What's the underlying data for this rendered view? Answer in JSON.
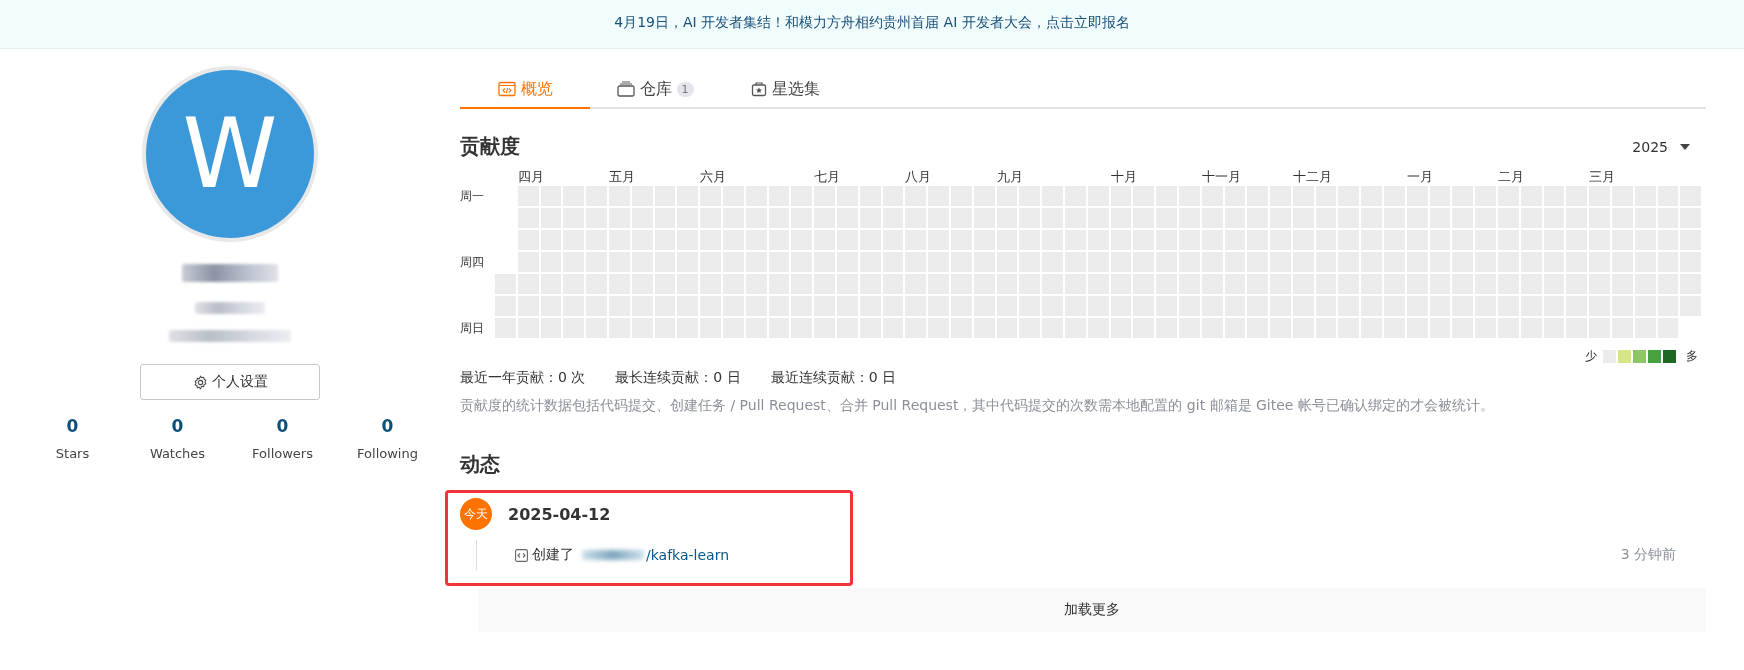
{
  "banner": {
    "text": "4月19日，AI 开发者集结！和模力方舟相约贵州首届 AI 开发者大会，点击立即报名"
  },
  "profile": {
    "avatar_letter": "W",
    "settings_button": "个人设置",
    "stats": [
      {
        "value": "0",
        "label": "Stars"
      },
      {
        "value": "0",
        "label": "Watches"
      },
      {
        "value": "0",
        "label": "Followers"
      },
      {
        "value": "0",
        "label": "Following"
      }
    ]
  },
  "tabs": [
    {
      "label": "概览",
      "kind": "overview",
      "selected": true
    },
    {
      "label": "仓库",
      "kind": "repos",
      "badge": "1",
      "selected": false
    },
    {
      "label": "星选集",
      "kind": "collections",
      "selected": false
    }
  ],
  "contributions": {
    "title": "贡献度",
    "year": "2025",
    "months": [
      "四月",
      "五月",
      "六月",
      "七月",
      "八月",
      "九月",
      "十月",
      "十一月",
      "十二月",
      "一月",
      "二月",
      "三月"
    ],
    "weekdays": [
      "周一",
      "周四",
      "周日"
    ],
    "legend": {
      "less": "少",
      "more": "多",
      "levels": [
        {
          "color": "#ebebeb"
        },
        {
          "color": "#d6e685"
        },
        {
          "color": "#8cc665"
        },
        {
          "color": "#44a340"
        },
        {
          "color": "#1e6823"
        }
      ]
    },
    "summary": [
      "最近一年贡献：0 次",
      "最长连续贡献：0 日",
      "最近连续贡献：0 日"
    ],
    "note": "贡献度的统计数据包括代码提交、创建任务 / Pull Request、合并 Pull Request，其中代码提交的次数需本地配置的 git 邮箱是 Gitee 帐号已确认绑定的才会被统计。"
  },
  "activity": {
    "title": "动态",
    "groups": [
      {
        "badge": "今天",
        "date": "2025-04-12",
        "events": [
          {
            "action": "创建了",
            "repo": "/kafka-learn",
            "time": "3 分钟前"
          }
        ]
      }
    ],
    "load_more": "加载更多"
  }
}
